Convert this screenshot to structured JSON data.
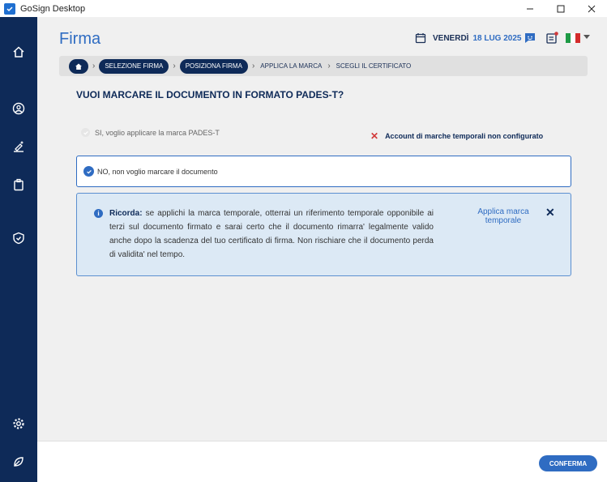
{
  "window": {
    "title": "GoSign Desktop"
  },
  "header": {
    "page_title": "Firma",
    "day": "VENERDÌ",
    "date": "18 LUG 2025"
  },
  "breadcrumb": {
    "items": [
      {
        "label": "SELEZIONE FIRMA",
        "active": true
      },
      {
        "label": "POSIZIONA FIRMA",
        "active": true
      },
      {
        "label": "APPLICA LA MARCA",
        "active": false
      },
      {
        "label": "SCEGLI IL CERTIFICATO",
        "active": false
      }
    ]
  },
  "main": {
    "question": "VUOI MARCARE IL DOCUMENTO IN FORMATO PADES-T?",
    "option_yes": "SI, voglio applicare la marca PADES-T",
    "warning": "Account di marche temporali non configurato",
    "option_no": "NO, non voglio marcare il documento",
    "info": {
      "title": "Ricorda:",
      "text": " se applichi la marca temporale, otterrai un riferimento temporale opponibile ai terzi sul documento firmato e sarai certo che il documento rimarra' legalmente valido anche dopo la scadenza del tuo certificato di firma. Non rischiare che il documento perda di validita' nel tempo.",
      "link": "Applica marca temporale"
    }
  },
  "footer": {
    "confirm": "CONFERMA"
  },
  "colors": {
    "sidebar": "#0e2a58",
    "accent": "#2f6cc2",
    "info_bg": "#dce9f5",
    "error": "#d23a3a"
  }
}
